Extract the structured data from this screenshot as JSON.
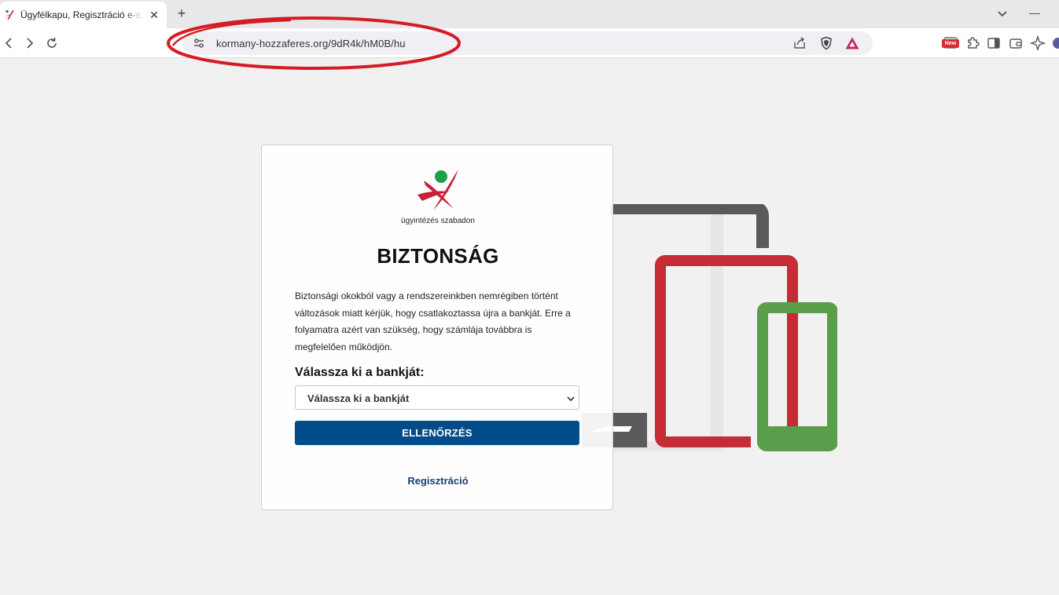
{
  "browser": {
    "tab": {
      "title": "Ügyfélkapu, Regisztráció e-szem",
      "close_glyph": "✕"
    },
    "new_tab_glyph": "+",
    "window_minimize_glyph": "—",
    "address_bar": {
      "url": "kormany-hozzaferes.org/9dR4k/hM0B/hu"
    },
    "extensions": {
      "new_badge": "New"
    },
    "icons": [
      "back-icon",
      "forward-icon",
      "reload-icon",
      "site-settings-icon",
      "share-icon",
      "brave-shield-icon",
      "brave-rewards-triangle-icon",
      "puzzle-extensions-icon",
      "sidebar-icon",
      "wallet-icon",
      "leo-ai-icon"
    ]
  },
  "page": {
    "logo_caption": "ügyintézés szabadon",
    "title": "BIZTONSÁG",
    "body_text": "Biztonsági okokból vagy a rendszereinkben nemrégiben történt változások miatt kérjük, hogy csatlakoztassa újra a bankját. Erre a folyamatra azért van szükség, hogy számlája továbbra is megfelelően működjön.",
    "bank_label": "Válassza ki a bankját:",
    "bank_select_value": "Válassza ki a bankját",
    "check_button": "ELLENŐRZÉS",
    "register_link": "Regisztráció"
  },
  "colors": {
    "primary_button": "#034c8a",
    "link": "#17406b",
    "logo_red": "#c8203a",
    "logo_green": "#1e9f48",
    "device_gray": "#5a5a5c",
    "device_red": "#c62c36",
    "device_green": "#5a9e4b",
    "annotation_ellipse": "#d41c24"
  }
}
